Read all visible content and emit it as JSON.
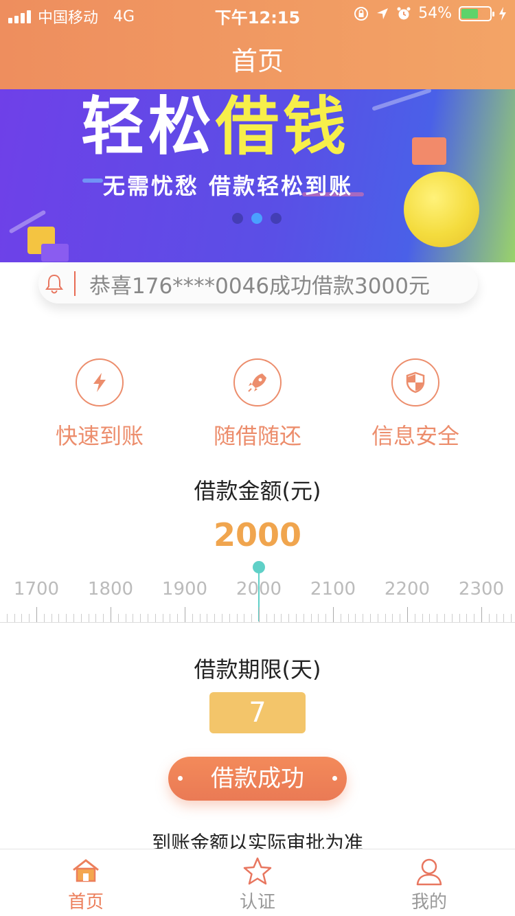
{
  "status_bar": {
    "carrier": "中国移动",
    "network": "4G",
    "time": "下午12:15",
    "battery_percent": "54%",
    "battery_level": 0.54
  },
  "header": {
    "title": "首页"
  },
  "banner": {
    "title_part1": "轻松",
    "title_part2": "借钱",
    "subtitle": "无需忧愁 借款轻松到账",
    "page_count": 3,
    "active_page": 1
  },
  "notice": {
    "text": "恭喜176****0046成功借款3000元",
    "icon": "bell-icon"
  },
  "features": [
    {
      "label": "快速到账",
      "icon": "lightning-icon"
    },
    {
      "label": "随借随还",
      "icon": "rocket-icon"
    },
    {
      "label": "信息安全",
      "icon": "shield-icon"
    }
  ],
  "amount": {
    "title": "借款金额(元)",
    "value": "2000",
    "ruler_labels": [
      "1700",
      "1800",
      "1900",
      "2000",
      "2100",
      "2200",
      "2300"
    ]
  },
  "term": {
    "title": "借款期限(天)",
    "value": "7"
  },
  "action": {
    "button_label": "借款成功"
  },
  "tip": "到账金额以实际审批为准",
  "tabbar": {
    "items": [
      {
        "label": "首页",
        "icon": "home-icon",
        "active": true
      },
      {
        "label": "认证",
        "icon": "star-icon",
        "active": false
      },
      {
        "label": "我的",
        "icon": "user-icon",
        "active": false
      }
    ]
  },
  "colors": {
    "header_start": "#ee8e5e",
    "header_end": "#f3a466",
    "accent": "#ec8d6c",
    "amount": "#f0a54e",
    "term_box": "#f3c56a",
    "pointer": "#5fd0c7"
  }
}
